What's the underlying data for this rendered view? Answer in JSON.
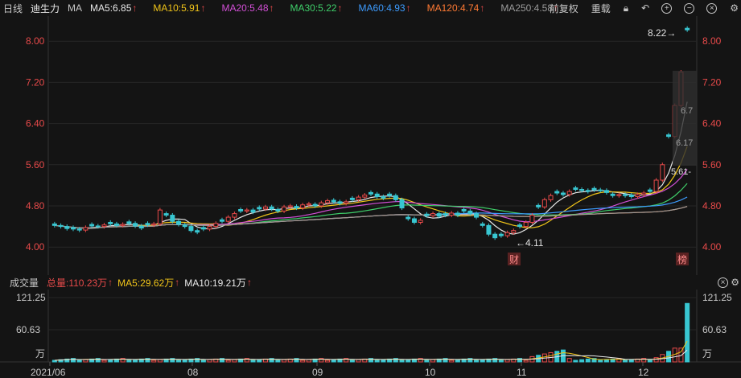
{
  "toolbar": {
    "period": "日线",
    "stock_name": "迪生力",
    "ma_label": "MA",
    "adjust": "前复权",
    "reset": "重载"
  },
  "ma_items": [
    {
      "text": "MA5:6.85",
      "color": "#e8e8e8"
    },
    {
      "text": "MA10:5.91",
      "color": "#f0c419"
    },
    {
      "text": "MA20:5.48",
      "color": "#d24fd6"
    },
    {
      "text": "MA30:5.22",
      "color": "#3fcf6a"
    },
    {
      "text": "MA60:4.93",
      "color": "#3d9cff"
    },
    {
      "text": "MA120:4.74",
      "color": "#ff7a33"
    },
    {
      "text": "MA250:4.58",
      "color": "#9a9a9a"
    }
  ],
  "price_axis": {
    "ticks": [
      "8.00",
      "7.20",
      "6.40",
      "5.60",
      "4.80",
      "4.00"
    ],
    "max_label": "8.22→",
    "min_label": "←4.11",
    "box_labels": [
      "6.7",
      "6.17",
      "5.61-"
    ],
    "badge_cai": "财",
    "badge_bang": "榜"
  },
  "volume": {
    "title": "成交量",
    "total": "总量:110.23万",
    "ma5": "MA5:29.62万",
    "ma10": "MA10:19.21万",
    "ticks": [
      "121.25",
      "60.63",
      "万"
    ]
  },
  "x_axis": {
    "labels": [
      "2021/06",
      "08",
      "09",
      "10",
      "11",
      "12"
    ]
  },
  "colors": {
    "up": "#e84a4a",
    "down": "#38c6d1",
    "grid": "#2a2a2a",
    "background": "#141414"
  },
  "chart_data": {
    "type": "candlestick",
    "ylim": [
      3.8,
      8.3
    ],
    "close": [
      4.42,
      4.4,
      4.36,
      4.35,
      4.33,
      4.38,
      4.41,
      4.4,
      4.43,
      4.45,
      4.42,
      4.44,
      4.46,
      4.41,
      4.37,
      4.43,
      4.45,
      4.72,
      4.62,
      4.5,
      4.44,
      4.4,
      4.32,
      4.29,
      4.35,
      4.4,
      4.46,
      4.5,
      4.58,
      4.65,
      4.7,
      4.72,
      4.68,
      4.74,
      4.78,
      4.74,
      4.7,
      4.78,
      4.8,
      4.76,
      4.82,
      4.84,
      4.8,
      4.86,
      4.9,
      4.88,
      4.85,
      4.88,
      4.92,
      4.97,
      5.01,
      5.03,
      4.98,
      4.95,
      5.0,
      4.92,
      4.76,
      4.55,
      4.48,
      4.52,
      4.61,
      4.65,
      4.6,
      4.62,
      4.66,
      4.62,
      4.7,
      4.65,
      4.58,
      4.42,
      4.25,
      4.18,
      4.22,
      4.28,
      4.32,
      4.4,
      4.48,
      4.62,
      4.78,
      4.92,
      5.0,
      5.05,
      5.02,
      5.08,
      5.12,
      5.1,
      5.08,
      5.11,
      5.1,
      5.06,
      5.0,
      5.02,
      5.0,
      4.98,
      5.02,
      5.05,
      5.08,
      5.3,
      5.6,
      6.15,
      6.75,
      7.4,
      8.22
    ],
    "volume_ticks": [
      121.25,
      60.63
    ],
    "volume_max": 121.25
  }
}
